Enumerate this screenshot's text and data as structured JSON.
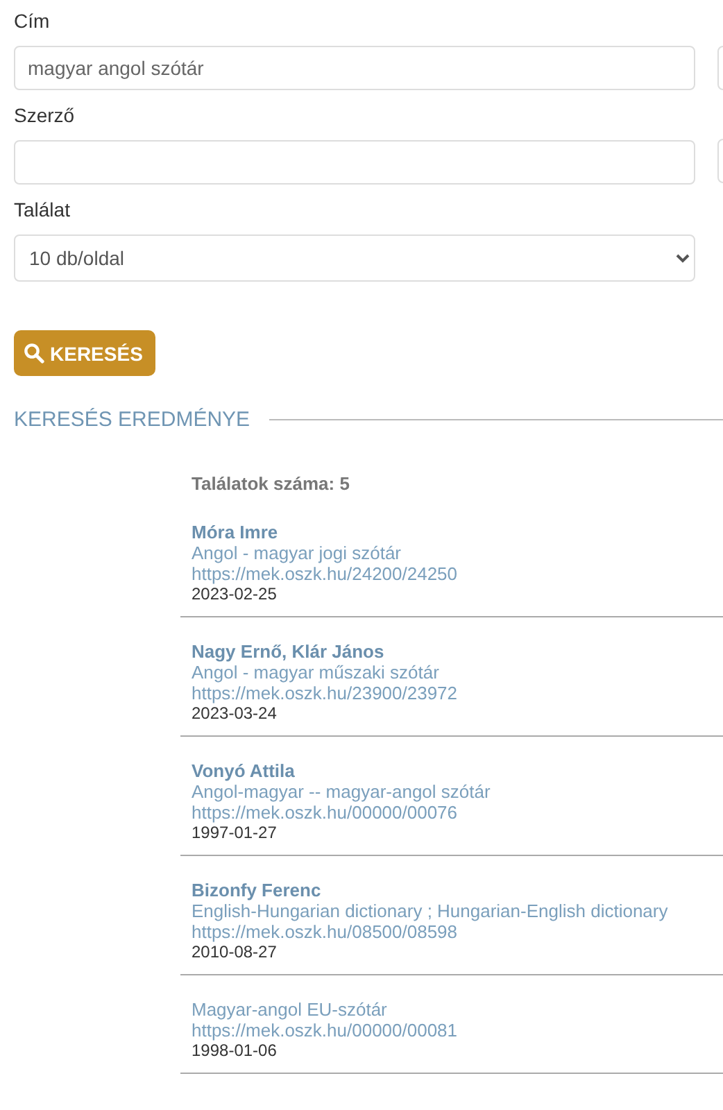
{
  "form": {
    "fields": [
      {
        "label": "Cím",
        "kind": "text",
        "value": "magyar angol szótár"
      },
      {
        "label": "Szerző",
        "kind": "text"
      },
      {
        "label": "Találat",
        "kind": "select",
        "value": "10 db/oldal"
      }
    ],
    "search_button": "KERESÉS"
  },
  "results": {
    "heading": "KERESÉS EREDMÉNYE",
    "count": "Találatok száma: 5",
    "items": [
      {
        "author": "Móra Imre",
        "title": "Angol - magyar jogi szótár",
        "url": "https://mek.oszk.hu/24200/24250",
        "date": "2023-02-25"
      },
      {
        "author": "Nagy Ernő, Klár János",
        "title": "Angol - magyar műszaki szótár",
        "url": "https://mek.oszk.hu/23900/23972",
        "date": "2023-03-24"
      },
      {
        "author": "Vonyó Attila",
        "title": "Angol-magyar -- magyar-angol szótár",
        "url": "https://mek.oszk.hu/00000/00076",
        "date": "1997-01-27"
      },
      {
        "author": "Bizonfy Ferenc",
        "title": "English-Hungarian dictionary ; Hungarian-English dictionary",
        "url": "https://mek.oszk.hu/08500/08598",
        "date": "2010-08-27"
      },
      {
        "title": "Magyar-angol EU-szótár",
        "url": "https://mek.oszk.hu/00000/00081",
        "date": "1998-01-06"
      }
    ]
  }
}
